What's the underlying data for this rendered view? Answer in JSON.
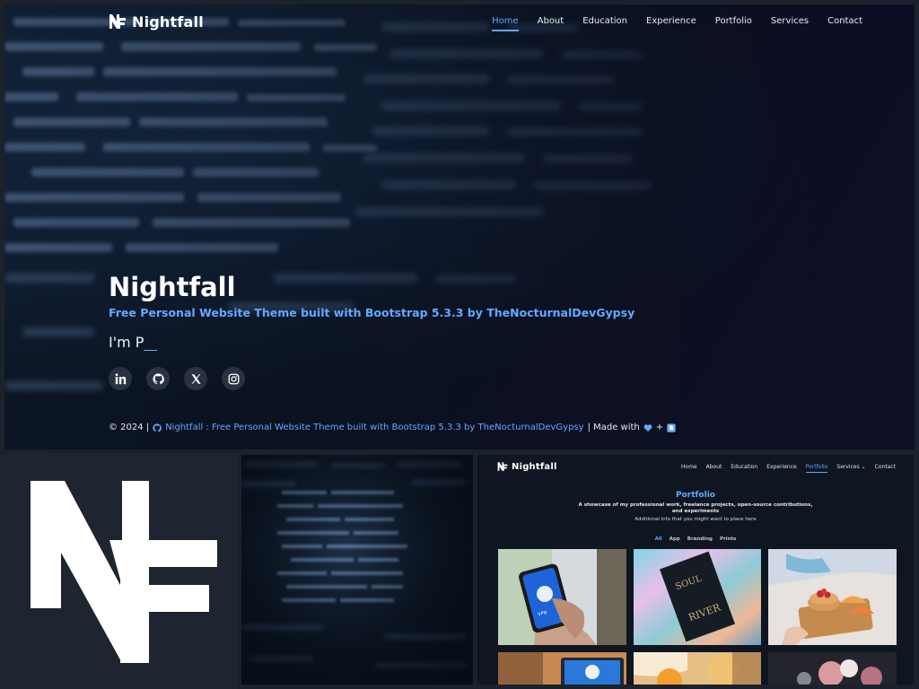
{
  "hero": {
    "brand_name": "Nightfall",
    "nav": [
      "Home",
      "About",
      "Education",
      "Experience",
      "Portfolio",
      "Services",
      "Contact"
    ],
    "title": "Nightfall",
    "subtitle": "Free Personal Website Theme built with Bootstrap 5.3.3 by TheNocturnalDevGypsy",
    "typed_prefix": "I'm P",
    "socials": [
      "linkedin-icon",
      "github-icon",
      "x-icon",
      "instagram-icon"
    ],
    "footer": {
      "copyright": "© 2024 |",
      "link": "Nightfall : Free Personal Website Theme built with Bootstrap 5.3.3 by TheNocturnalDevGypsy",
      "made_with": "| Made with",
      "plus": "+"
    }
  },
  "preview": {
    "brand_name": "Nightfall",
    "nav": [
      "Home",
      "About",
      "Education",
      "Experience",
      "Portfolio",
      "Services",
      "Contact"
    ],
    "section_title": "Portfolio",
    "description": "A showcase of my professional work, freelance projects, open-source contributions, and experiments",
    "info": "Additional info that you might want to place here",
    "filters": [
      "All",
      "App",
      "Branding",
      "Prints"
    ],
    "card_art": {
      "vpn_screen": "VPN"
    }
  },
  "colors": {
    "accent": "#5fa8ff",
    "background": "#1c222c",
    "hero_dark": "#0b1424"
  }
}
